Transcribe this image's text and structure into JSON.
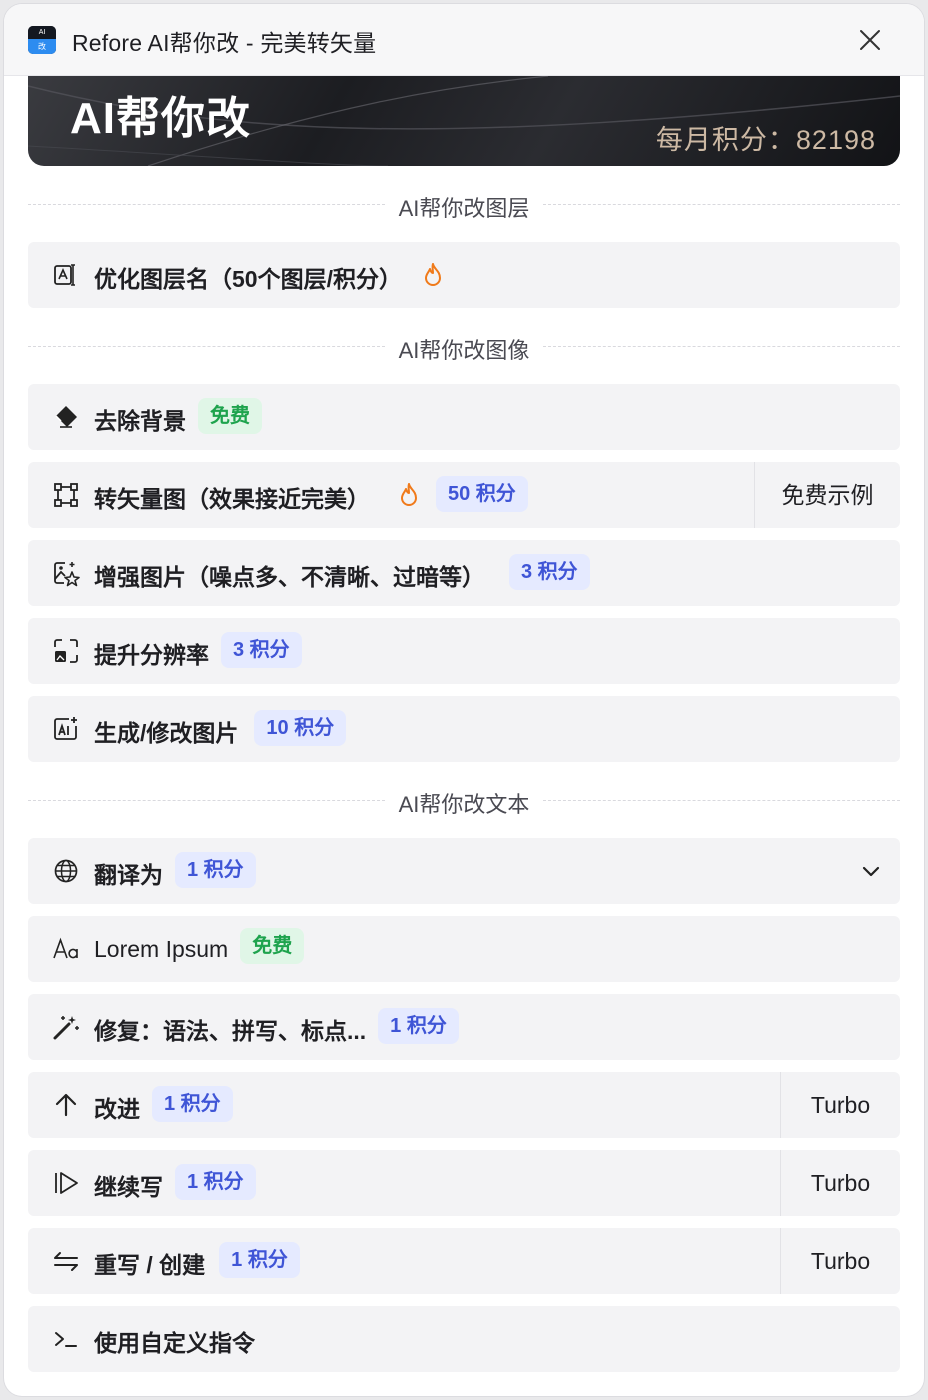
{
  "window": {
    "title": "Refore AI帮你改 - 完美转矢量",
    "logo_top": "AI",
    "logo_bottom": "改"
  },
  "banner": {
    "title": "AI帮你改",
    "credits": "每月积分：82198"
  },
  "sections": {
    "layers": "AI帮你改图层",
    "images": "AI帮你改图像",
    "text": "AI帮你改文本"
  },
  "items": {
    "rename_layers": {
      "label": "优化图层名（50个图层/积分）",
      "icon": "rename-icon"
    },
    "remove_bg": {
      "label": "去除背景",
      "badge": "免费",
      "icon": "eraser-icon"
    },
    "vectorize": {
      "label": "转矢量图（效果接近完美）",
      "badge": "50 积分",
      "side": "免费示例",
      "icon": "vector-icon"
    },
    "enhance": {
      "label": "增强图片（噪点多、不清晰、过暗等）",
      "badge": "3 积分",
      "icon": "enhance-image-icon"
    },
    "upscale": {
      "label": "提升分辨率",
      "badge": "3 积分",
      "icon": "upscale-icon"
    },
    "generate": {
      "label": "生成/修改图片",
      "badge": "10 积分",
      "icon": "ai-image-icon"
    },
    "translate": {
      "label": "翻译为",
      "badge": "1 积分",
      "icon": "globe-icon"
    },
    "lorem": {
      "label": "Lorem Ipsum",
      "badge": "免费",
      "icon": "font-icon"
    },
    "fix": {
      "label": "修复：语法、拼写、标点...",
      "badge": "1 积分",
      "icon": "magic-wand-icon"
    },
    "improve": {
      "label": "改进",
      "badge": "1 积分",
      "side": "Turbo",
      "icon": "arrow-up-icon"
    },
    "continue": {
      "label": "继续写",
      "badge": "1 积分",
      "side": "Turbo",
      "icon": "play-icon"
    },
    "rewrite": {
      "label": "重写 / 创建",
      "badge": "1 积分",
      "side": "Turbo",
      "icon": "swap-icon"
    },
    "custom": {
      "label": "使用自定义指令",
      "icon": "terminal-icon"
    }
  },
  "colors": {
    "badge_blue_bg": "#e5eaff",
    "badge_blue_text": "#3f55d6",
    "badge_green_bg": "#e0f6e7",
    "badge_green_text": "#1ea34d",
    "flame": "#f07a1a",
    "credits_text": "#cdb9a4"
  }
}
